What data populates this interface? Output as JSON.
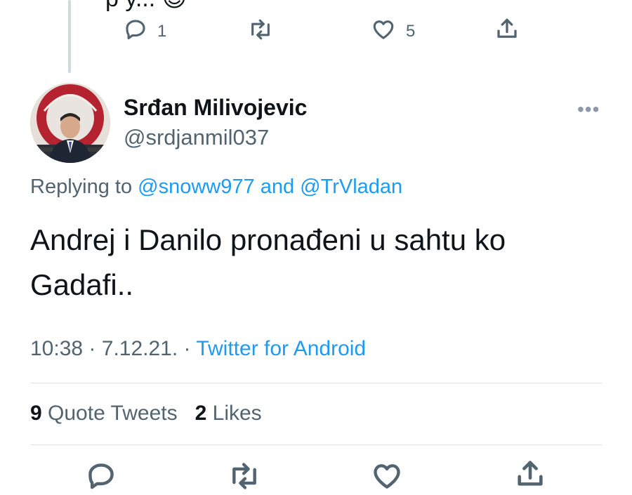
{
  "previous_tweet": {
    "text_partial": "p         y... 😊",
    "actions": {
      "reply_count": "1",
      "retweet_count": "",
      "like_count": "5"
    },
    "icons": [
      "reply-icon",
      "retweet-icon",
      "like-icon",
      "share-icon"
    ]
  },
  "tweet": {
    "display_name": "Srđan Milivojevic",
    "handle": "@srdjanmil037",
    "more_label": "•••",
    "replying_prefix": "Replying to",
    "reply_user_1": "@snoww977",
    "reply_and": "and",
    "reply_user_2": "@TrVladan",
    "text_line_1": "Andrej i Danilo pronađeni u sahtu ko",
    "text_line_2": "Gadafi..",
    "time": "10:38",
    "date": "7.12.21.",
    "source": "Twitter for Android"
  },
  "stats": {
    "quote_count": "9",
    "quote_label": "Quote Tweets",
    "like_count": "2",
    "like_label": "Likes"
  },
  "colors": {
    "link": "#1d9bf0",
    "secondary": "#536471",
    "primary": "#0f1419"
  }
}
